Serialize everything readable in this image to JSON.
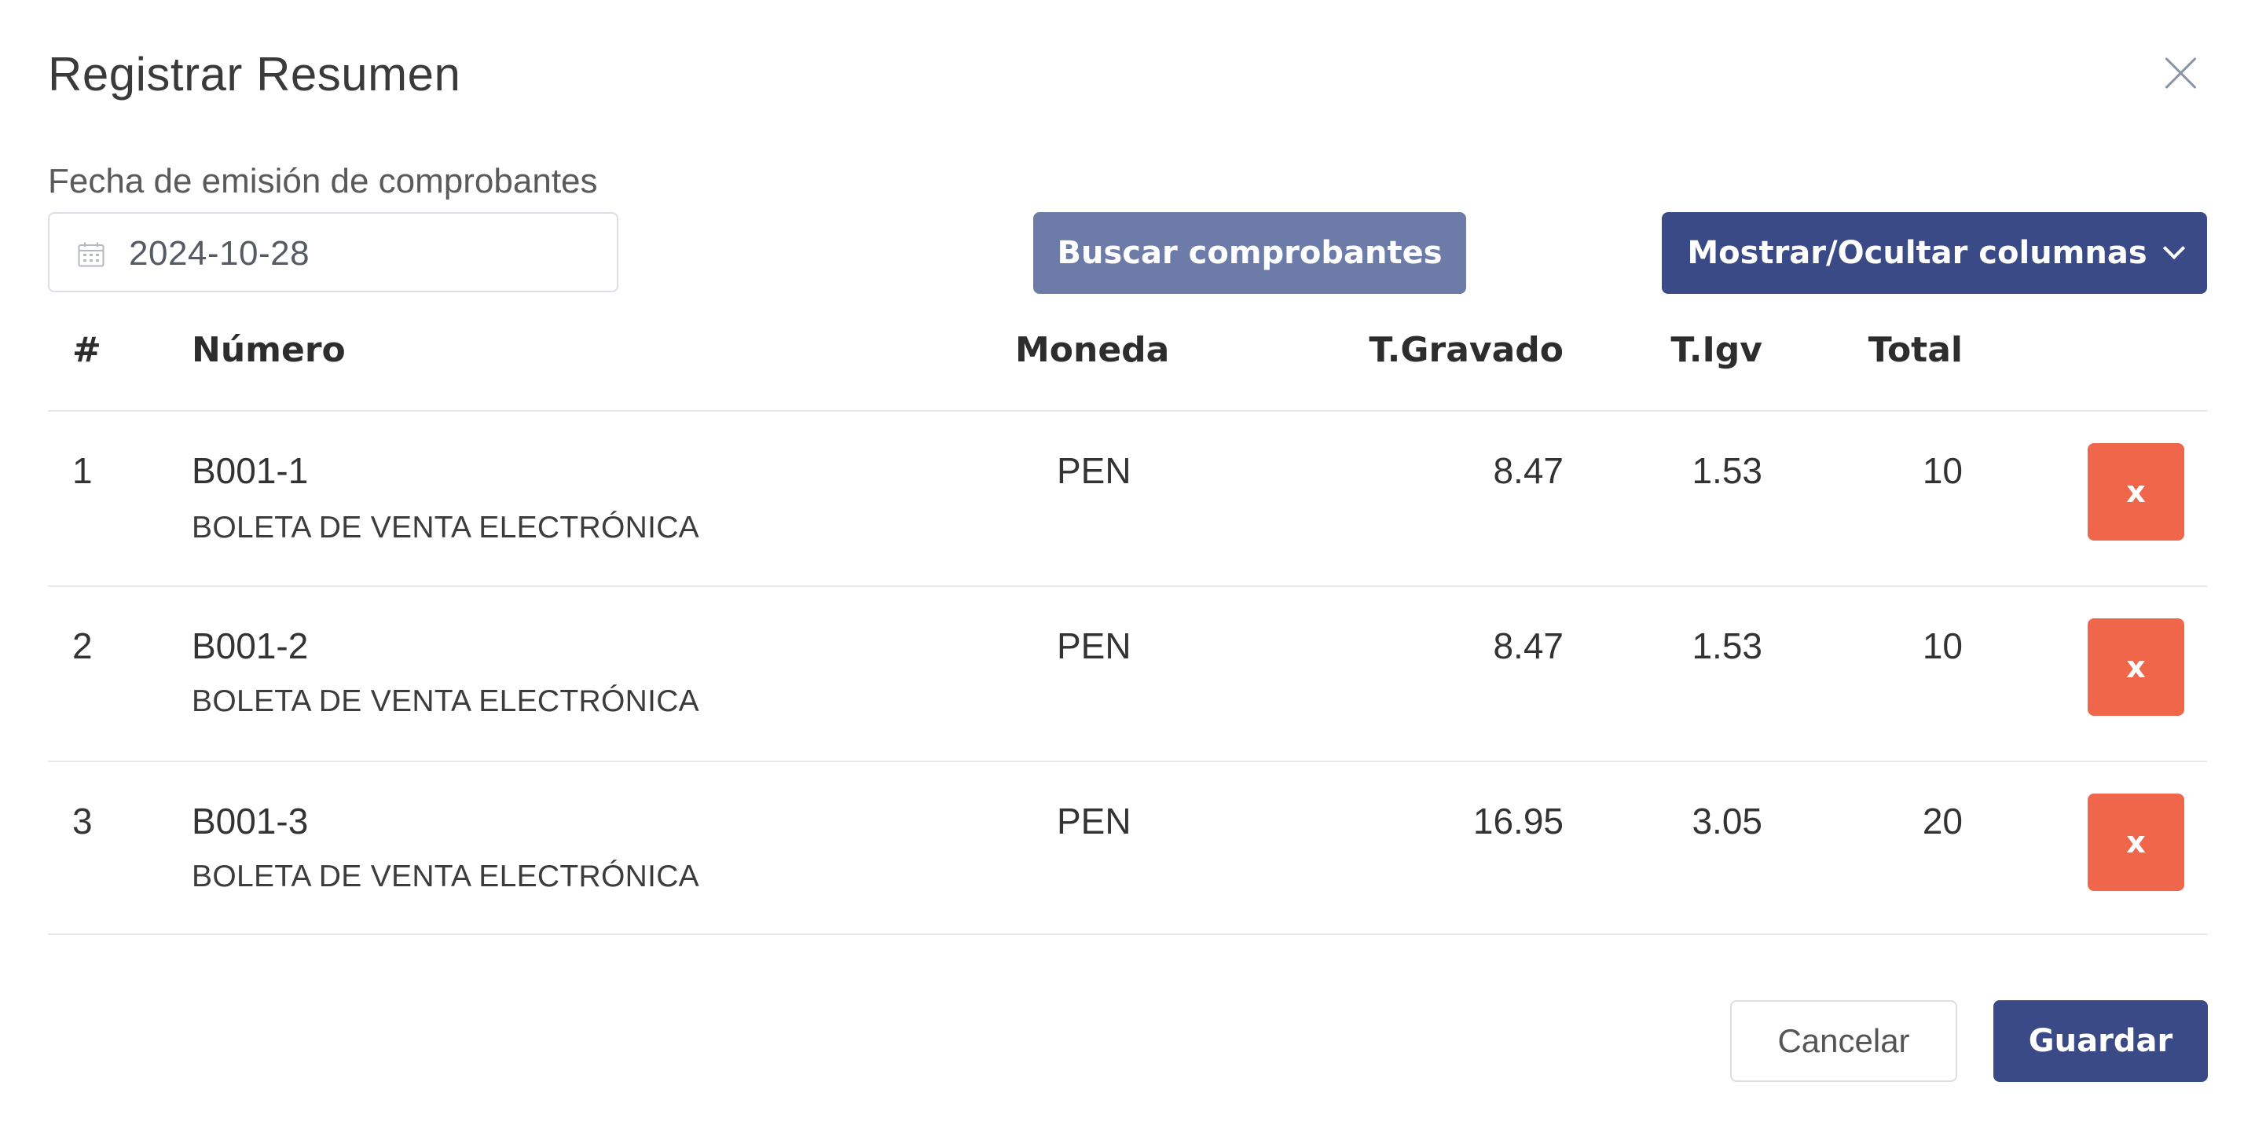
{
  "dialog": {
    "title": "Registrar Resumen",
    "close_icon": "close-icon"
  },
  "form": {
    "date_label": "Fecha de emisión de comprobantes",
    "date_value": "2024-10-28",
    "date_icon": "calendar-icon",
    "search_button": "Buscar comprobantes",
    "columns_button": "Mostrar/Ocultar columnas",
    "columns_icon": "chevron-down-icon"
  },
  "table": {
    "headers": {
      "index": "#",
      "number": "Número",
      "currency": "Moneda",
      "taxed": "T.Gravado",
      "igv": "T.Igv",
      "total": "Total"
    },
    "rows": [
      {
        "index": "1",
        "number": "B001-1",
        "doc_type": "BOLETA DE VENTA ELECTRÓNICA",
        "currency": "PEN",
        "taxed": "8.47",
        "igv": "1.53",
        "total": "10",
        "delete_label": "x"
      },
      {
        "index": "2",
        "number": "B001-2",
        "doc_type": "BOLETA DE VENTA ELECTRÓNICA",
        "currency": "PEN",
        "taxed": "8.47",
        "igv": "1.53",
        "total": "10",
        "delete_label": "x"
      },
      {
        "index": "3",
        "number": "B001-3",
        "doc_type": "BOLETA DE VENTA ELECTRÓNICA",
        "currency": "PEN",
        "taxed": "16.95",
        "igv": "3.05",
        "total": "20",
        "delete_label": "x"
      }
    ]
  },
  "footer": {
    "cancel_button": "Cancelar",
    "save_button": "Guardar"
  },
  "colors": {
    "primary": "#3a4a86",
    "primary_light": "#6d7ba9",
    "danger": "#f0664a"
  }
}
